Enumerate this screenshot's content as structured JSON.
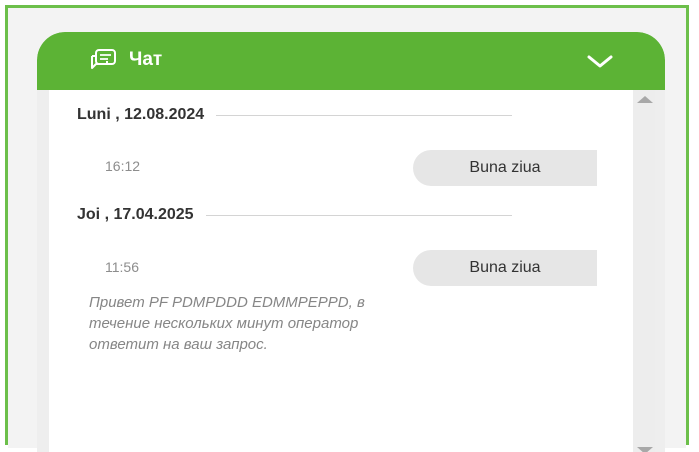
{
  "chat": {
    "title": "Чат",
    "icon": "chat-bubbles-icon",
    "collapse_icon": "chevron-down-icon",
    "accent_color": "#5cb335",
    "days": [
      {
        "date": "Luni , 12.08.2024",
        "messages": [
          {
            "time": "16:12",
            "text": "Buna ziua"
          }
        ]
      },
      {
        "date": "Joi , 17.04.2025",
        "messages": [
          {
            "time": "11:56",
            "text": "Buna ziua"
          }
        ]
      }
    ],
    "bot_reply": "Привет PF PDMPDDD EDMMPEPPD, в течение нескольких минут оператор ответит на ваш запрос."
  }
}
